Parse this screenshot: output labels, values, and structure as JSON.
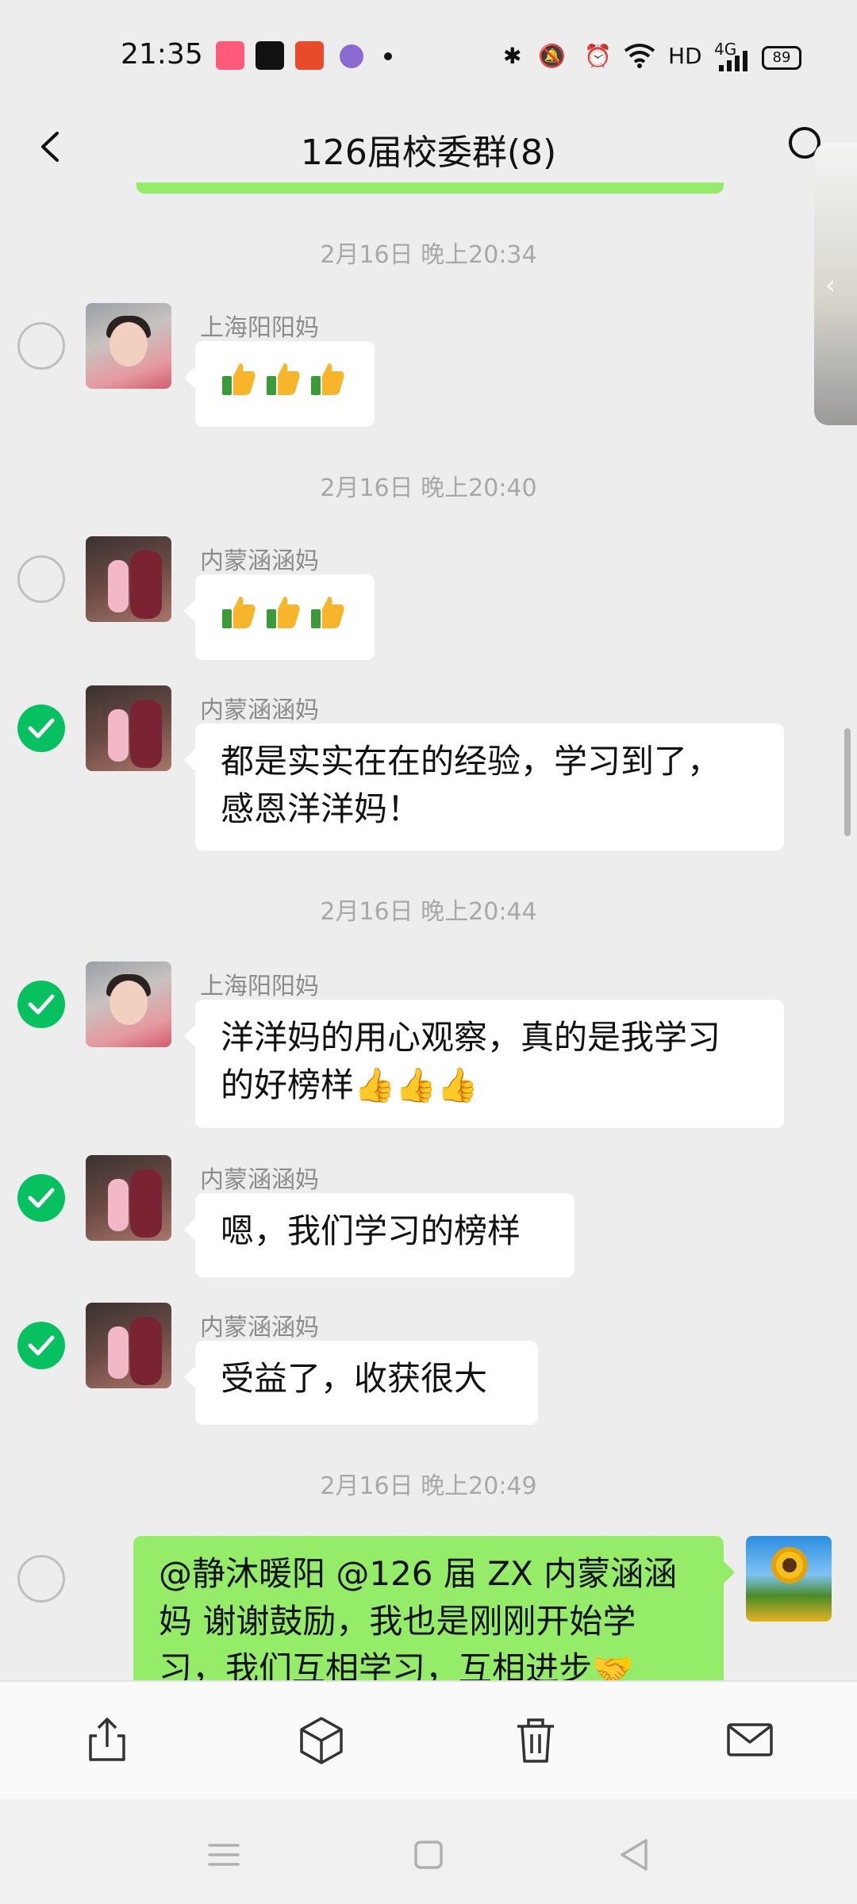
{
  "status_bar": {
    "time": "21:35",
    "network": "HD",
    "signal": "4G",
    "battery": "89"
  },
  "header": {
    "title": "126届校委群(8)"
  },
  "messages": [
    {
      "timestamp": "2月16日 晚上20:34",
      "sender": "上海阳阳妈",
      "content": "👍👍👍",
      "selected": false
    },
    {
      "timestamp": "2月16日 晚上20:40",
      "sender": "内蒙涵涵妈",
      "content": "👍👍👍",
      "selected": false
    },
    {
      "sender": "内蒙涵涵妈",
      "content_line1": "都是实实在在的经验，学习到了，",
      "content_line2": "感恩洋洋妈！",
      "selected": true
    },
    {
      "timestamp": "2月16日 晚上20:44",
      "sender": "上海阳阳妈",
      "content_line1": "洋洋妈的用心观察，真的是我学习",
      "content_line2": "的好榜样👍👍👍",
      "selected": true
    },
    {
      "sender": "内蒙涵涵妈",
      "content": "嗯，我们学习的榜样",
      "selected": true
    },
    {
      "sender": "内蒙涵涵妈",
      "content": "受益了，收获很大",
      "selected": true
    },
    {
      "timestamp": "2月16日 晚上20:49",
      "sender": "me",
      "content_line1": "@静沐暖阳 @126 届 ZX 内蒙涵涵",
      "content_line2": "妈 谢谢鼓励，我也是刚刚开始学",
      "content_line3": "习，我们互相学习，互相进步🤝",
      "selected": false
    }
  ],
  "toolbar": [
    "share-icon",
    "box-icon",
    "delete-icon",
    "mail-icon"
  ],
  "colors": {
    "accent": "#07c160",
    "my_bubble": "#95ec69",
    "background": "#ededed"
  }
}
